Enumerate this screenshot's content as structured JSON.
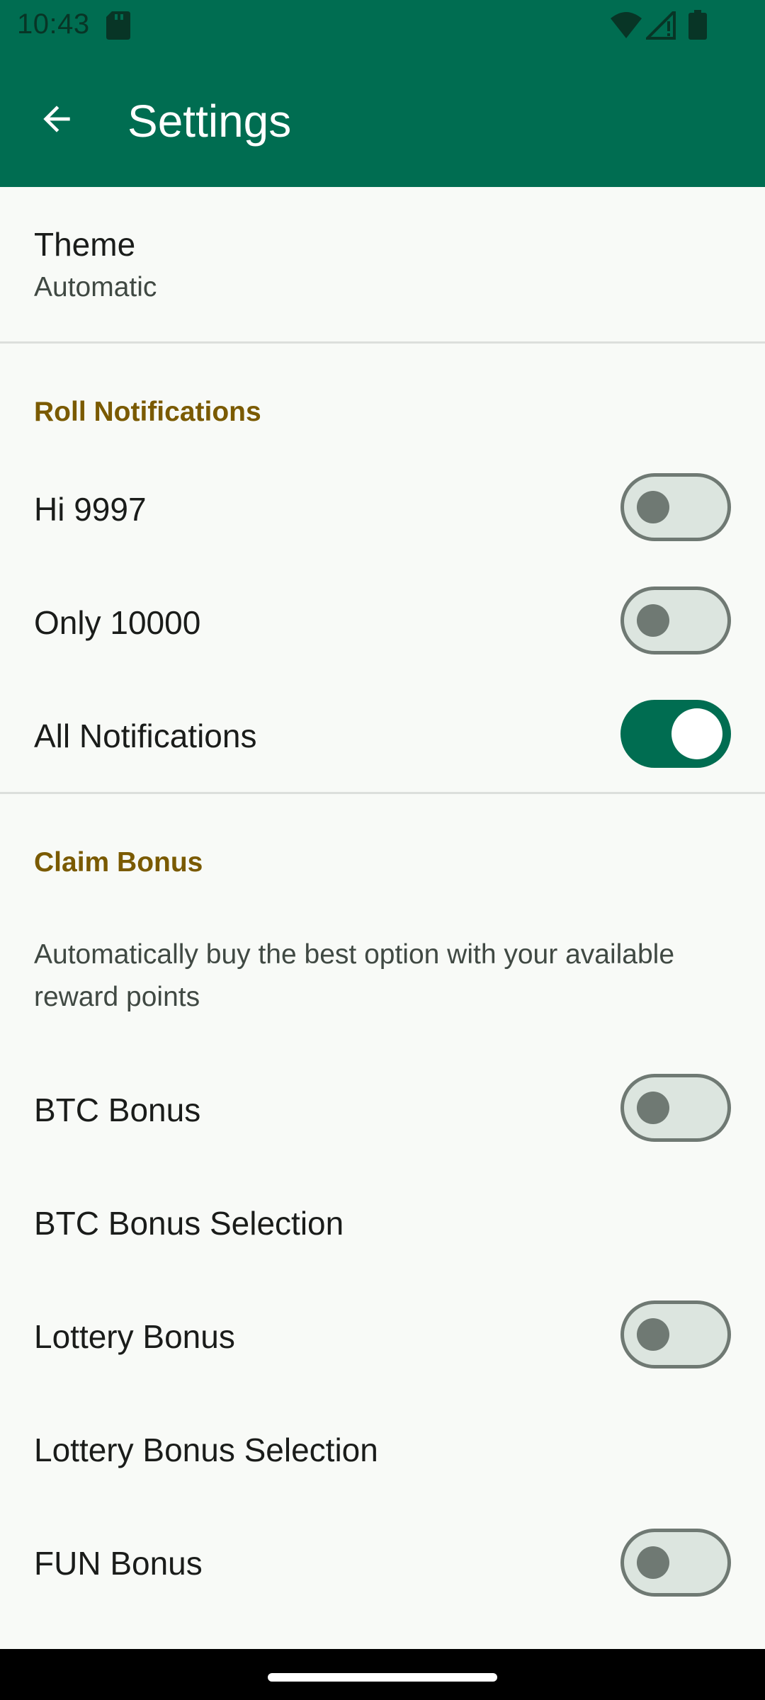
{
  "status_bar": {
    "time": "10:43",
    "icons": [
      "sd-card-icon",
      "wifi-icon",
      "signal-icon",
      "battery-icon"
    ]
  },
  "app_bar": {
    "title": "Settings",
    "back_icon": "arrow-back-icon",
    "background": "#006d51"
  },
  "theme": {
    "title": "Theme",
    "summary": "Automatic"
  },
  "roll_notifications": {
    "category": "Roll Notifications",
    "items": [
      {
        "label": "Hi 9997",
        "enabled": false
      },
      {
        "label": "Only 10000",
        "enabled": false
      },
      {
        "label": "All Notifications",
        "enabled": true
      }
    ]
  },
  "claim_bonus": {
    "category": "Claim Bonus",
    "description": "Automatically buy the best option with your available reward points",
    "btc_bonus": {
      "label": "BTC Bonus",
      "enabled": false
    },
    "btc_bonus_selection": {
      "label": "BTC Bonus Selection"
    },
    "lottery_bonus": {
      "label": "Lottery Bonus",
      "enabled": false
    },
    "lottery_bonus_selection": {
      "label": "Lottery Bonus Selection"
    },
    "fun_bonus": {
      "label": "FUN Bonus",
      "enabled": false
    }
  },
  "colors": {
    "primary": "#006d51",
    "category_text": "#7a5a00",
    "background": "#f8faf7"
  }
}
